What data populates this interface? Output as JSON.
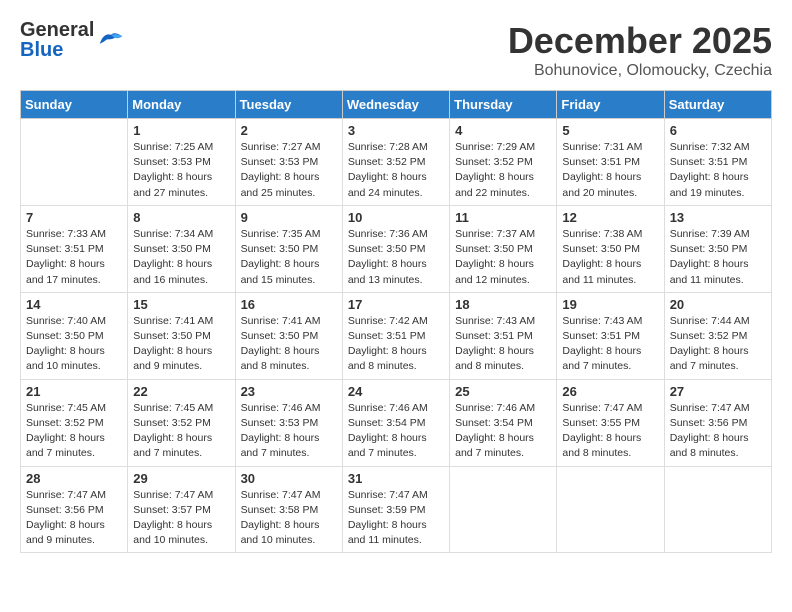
{
  "header": {
    "logo_general": "General",
    "logo_blue": "Blue",
    "month_title": "December 2025",
    "location": "Bohunovice, Olomoucky, Czechia"
  },
  "calendar": {
    "days_of_week": [
      "Sunday",
      "Monday",
      "Tuesday",
      "Wednesday",
      "Thursday",
      "Friday",
      "Saturday"
    ],
    "weeks": [
      [
        {
          "day": "",
          "info": ""
        },
        {
          "day": "1",
          "info": "Sunrise: 7:25 AM\nSunset: 3:53 PM\nDaylight: 8 hours\nand 27 minutes."
        },
        {
          "day": "2",
          "info": "Sunrise: 7:27 AM\nSunset: 3:53 PM\nDaylight: 8 hours\nand 25 minutes."
        },
        {
          "day": "3",
          "info": "Sunrise: 7:28 AM\nSunset: 3:52 PM\nDaylight: 8 hours\nand 24 minutes."
        },
        {
          "day": "4",
          "info": "Sunrise: 7:29 AM\nSunset: 3:52 PM\nDaylight: 8 hours\nand 22 minutes."
        },
        {
          "day": "5",
          "info": "Sunrise: 7:31 AM\nSunset: 3:51 PM\nDaylight: 8 hours\nand 20 minutes."
        },
        {
          "day": "6",
          "info": "Sunrise: 7:32 AM\nSunset: 3:51 PM\nDaylight: 8 hours\nand 19 minutes."
        }
      ],
      [
        {
          "day": "7",
          "info": "Sunrise: 7:33 AM\nSunset: 3:51 PM\nDaylight: 8 hours\nand 17 minutes."
        },
        {
          "day": "8",
          "info": "Sunrise: 7:34 AM\nSunset: 3:50 PM\nDaylight: 8 hours\nand 16 minutes."
        },
        {
          "day": "9",
          "info": "Sunrise: 7:35 AM\nSunset: 3:50 PM\nDaylight: 8 hours\nand 15 minutes."
        },
        {
          "day": "10",
          "info": "Sunrise: 7:36 AM\nSunset: 3:50 PM\nDaylight: 8 hours\nand 13 minutes."
        },
        {
          "day": "11",
          "info": "Sunrise: 7:37 AM\nSunset: 3:50 PM\nDaylight: 8 hours\nand 12 minutes."
        },
        {
          "day": "12",
          "info": "Sunrise: 7:38 AM\nSunset: 3:50 PM\nDaylight: 8 hours\nand 11 minutes."
        },
        {
          "day": "13",
          "info": "Sunrise: 7:39 AM\nSunset: 3:50 PM\nDaylight: 8 hours\nand 11 minutes."
        }
      ],
      [
        {
          "day": "14",
          "info": "Sunrise: 7:40 AM\nSunset: 3:50 PM\nDaylight: 8 hours\nand 10 minutes."
        },
        {
          "day": "15",
          "info": "Sunrise: 7:41 AM\nSunset: 3:50 PM\nDaylight: 8 hours\nand 9 minutes."
        },
        {
          "day": "16",
          "info": "Sunrise: 7:41 AM\nSunset: 3:50 PM\nDaylight: 8 hours\nand 8 minutes."
        },
        {
          "day": "17",
          "info": "Sunrise: 7:42 AM\nSunset: 3:51 PM\nDaylight: 8 hours\nand 8 minutes."
        },
        {
          "day": "18",
          "info": "Sunrise: 7:43 AM\nSunset: 3:51 PM\nDaylight: 8 hours\nand 8 minutes."
        },
        {
          "day": "19",
          "info": "Sunrise: 7:43 AM\nSunset: 3:51 PM\nDaylight: 8 hours\nand 7 minutes."
        },
        {
          "day": "20",
          "info": "Sunrise: 7:44 AM\nSunset: 3:52 PM\nDaylight: 8 hours\nand 7 minutes."
        }
      ],
      [
        {
          "day": "21",
          "info": "Sunrise: 7:45 AM\nSunset: 3:52 PM\nDaylight: 8 hours\nand 7 minutes."
        },
        {
          "day": "22",
          "info": "Sunrise: 7:45 AM\nSunset: 3:52 PM\nDaylight: 8 hours\nand 7 minutes."
        },
        {
          "day": "23",
          "info": "Sunrise: 7:46 AM\nSunset: 3:53 PM\nDaylight: 8 hours\nand 7 minutes."
        },
        {
          "day": "24",
          "info": "Sunrise: 7:46 AM\nSunset: 3:54 PM\nDaylight: 8 hours\nand 7 minutes."
        },
        {
          "day": "25",
          "info": "Sunrise: 7:46 AM\nSunset: 3:54 PM\nDaylight: 8 hours\nand 7 minutes."
        },
        {
          "day": "26",
          "info": "Sunrise: 7:47 AM\nSunset: 3:55 PM\nDaylight: 8 hours\nand 8 minutes."
        },
        {
          "day": "27",
          "info": "Sunrise: 7:47 AM\nSunset: 3:56 PM\nDaylight: 8 hours\nand 8 minutes."
        }
      ],
      [
        {
          "day": "28",
          "info": "Sunrise: 7:47 AM\nSunset: 3:56 PM\nDaylight: 8 hours\nand 9 minutes."
        },
        {
          "day": "29",
          "info": "Sunrise: 7:47 AM\nSunset: 3:57 PM\nDaylight: 8 hours\nand 10 minutes."
        },
        {
          "day": "30",
          "info": "Sunrise: 7:47 AM\nSunset: 3:58 PM\nDaylight: 8 hours\nand 10 minutes."
        },
        {
          "day": "31",
          "info": "Sunrise: 7:47 AM\nSunset: 3:59 PM\nDaylight: 8 hours\nand 11 minutes."
        },
        {
          "day": "",
          "info": ""
        },
        {
          "day": "",
          "info": ""
        },
        {
          "day": "",
          "info": ""
        }
      ]
    ]
  }
}
